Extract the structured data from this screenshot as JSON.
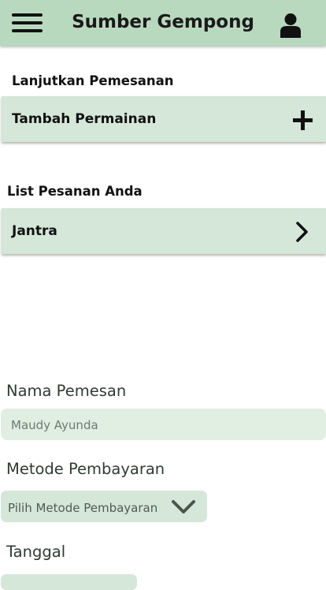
{
  "header": {
    "title": "Sumber Gempong",
    "menu_icon": "hamburger-menu-icon",
    "profile_icon": "user-icon",
    "color": "#b9d9bf"
  },
  "continue_section": {
    "label": "Lanjutkan Pemesanan",
    "add_game_label": "Tambah Permainan",
    "add_icon": "plus-icon"
  },
  "orders_section": {
    "label": "List Pesanan Anda",
    "items": [
      {
        "label": "Jantra",
        "icon": "chevron-right-icon"
      }
    ]
  },
  "form": {
    "name_label": "Nama Pemesan",
    "name_value": "Maudy Ayunda",
    "payment_label": "Metode Pembayaran",
    "payment_placeholder": "Pilih Metode Pembayaran",
    "payment_icon": "chevron-down-icon",
    "date_label": "Tanggal"
  },
  "colors": {
    "accent": "#b9d9bf",
    "row_background": "#d5e7d8",
    "input_background": "#e1efe2"
  }
}
